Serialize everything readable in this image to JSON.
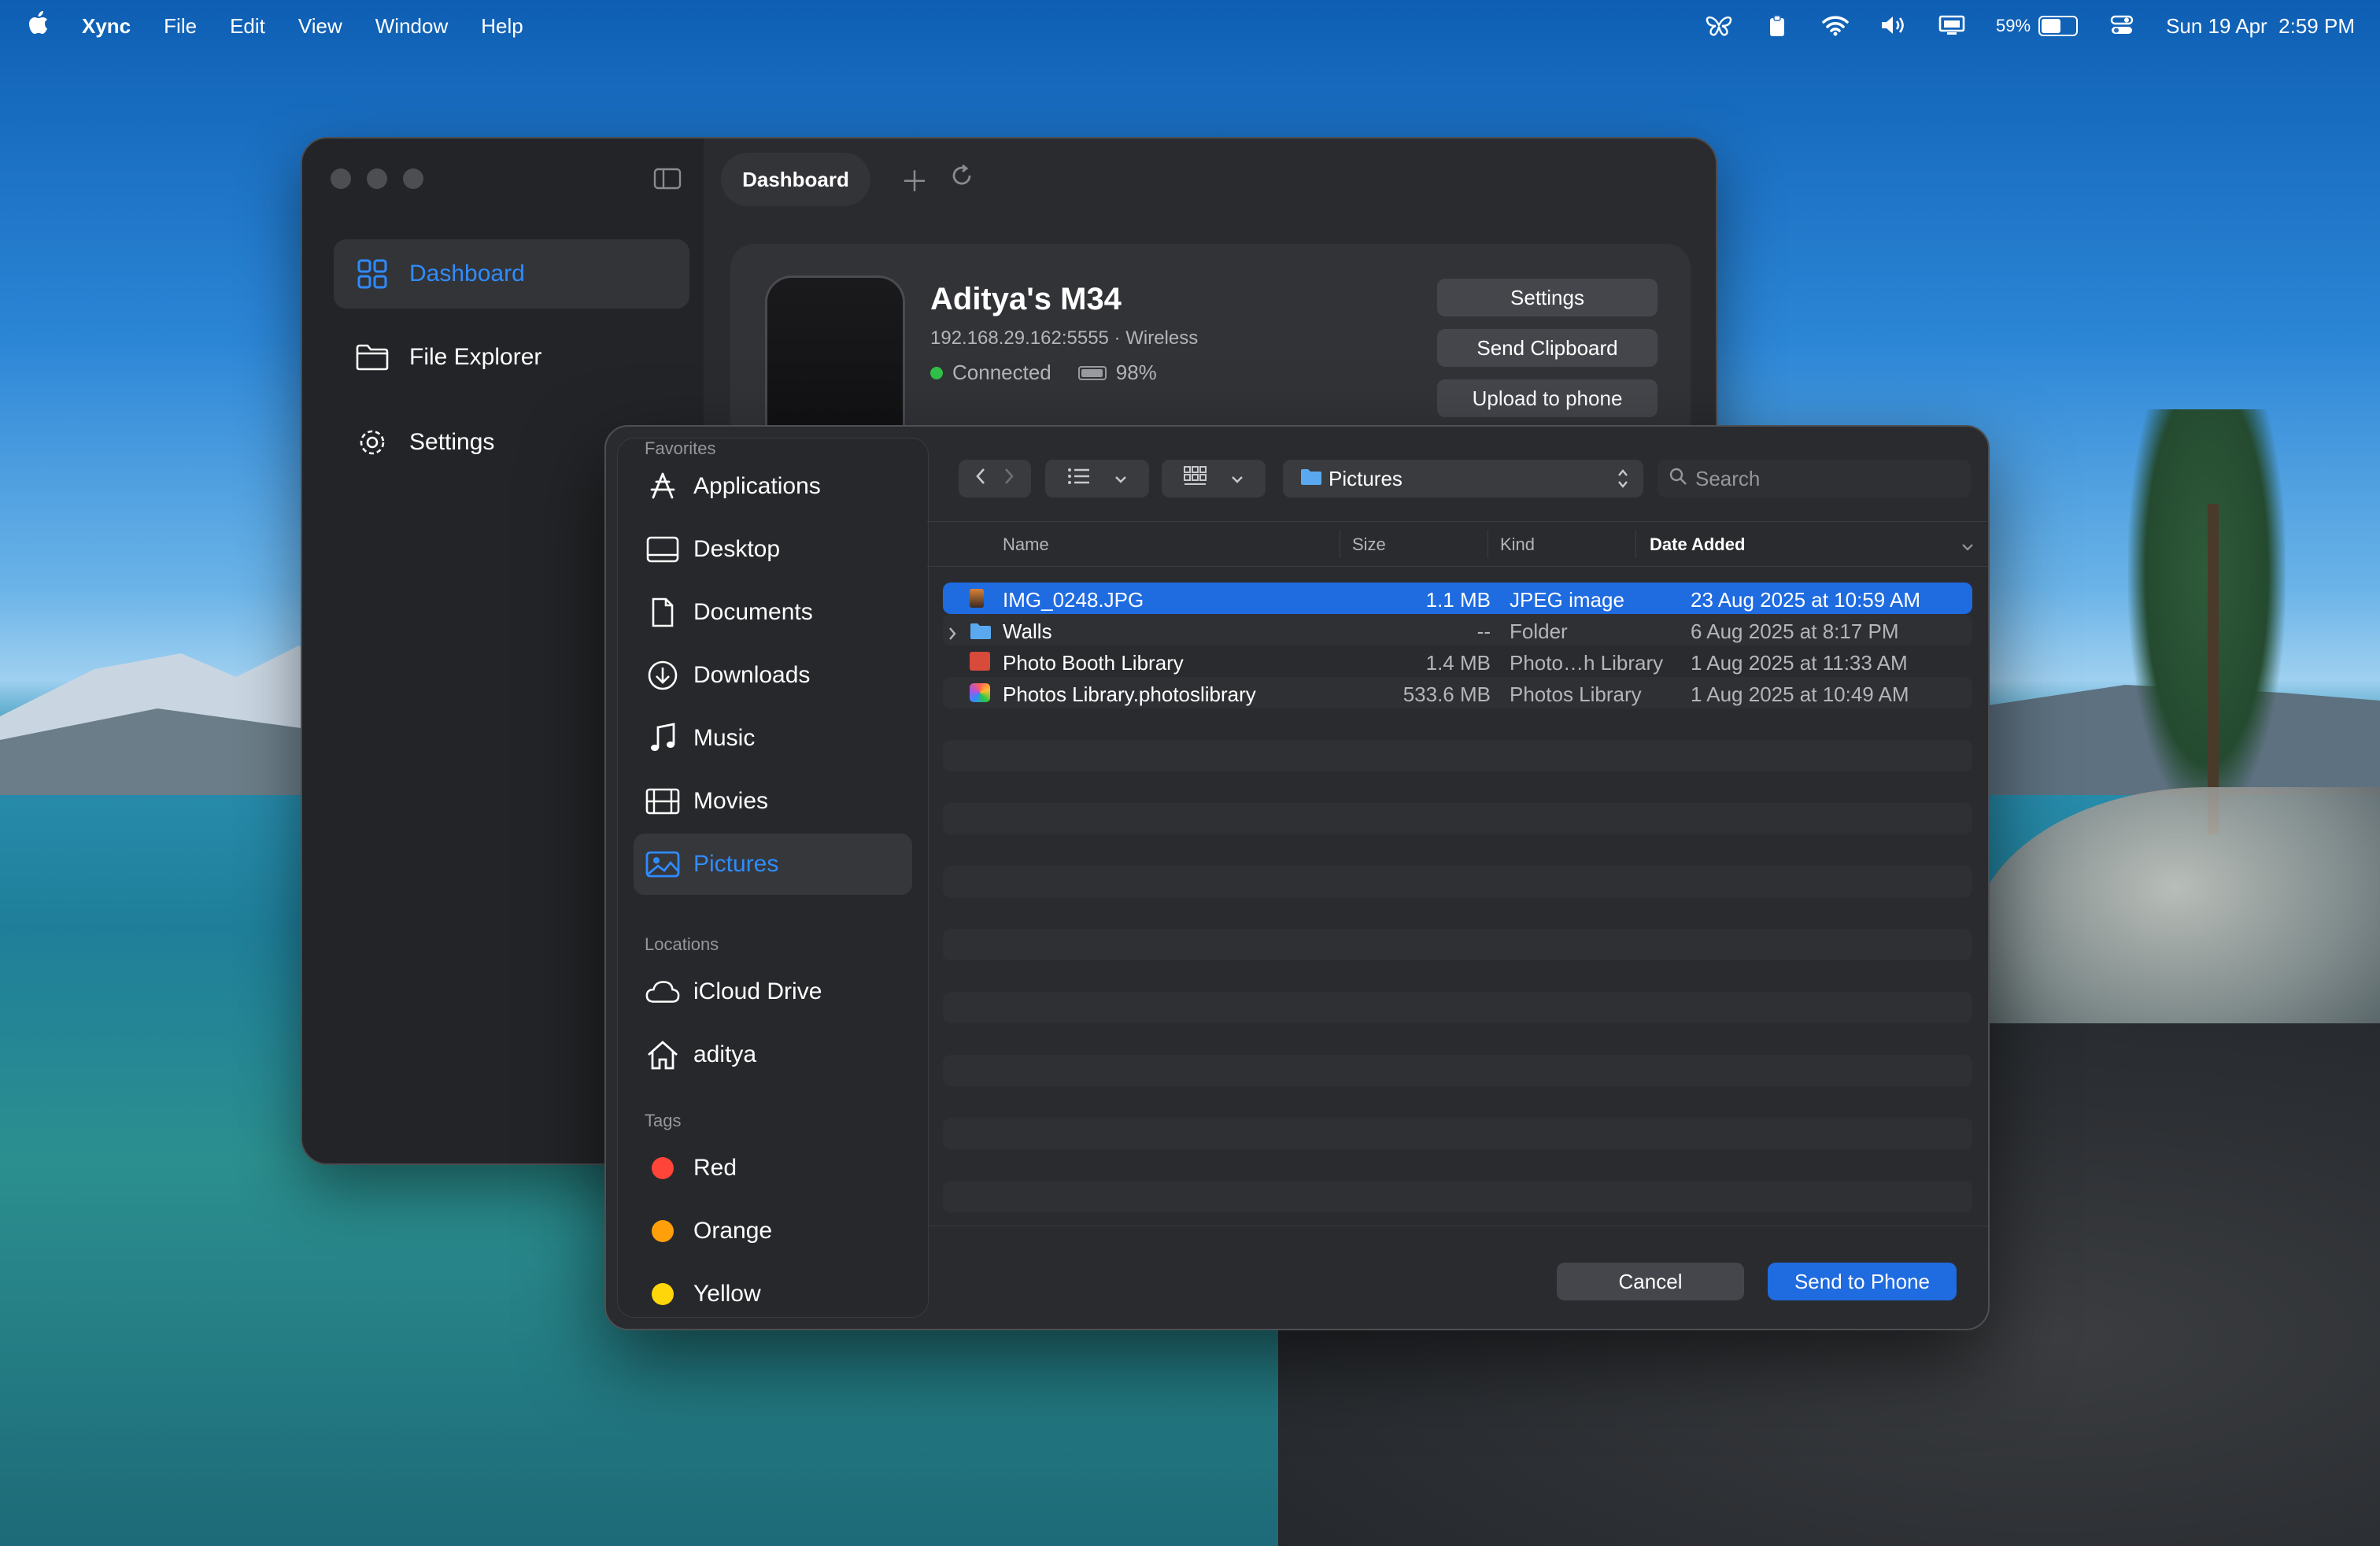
{
  "menubar": {
    "app_name": "Xync",
    "menus": [
      "File",
      "Edit",
      "View",
      "Window",
      "Help"
    ],
    "battery_percent": "59%",
    "battery_level": 0.59,
    "datetime": "Sun 19 Apr  2:59 PM"
  },
  "window": {
    "tab_title": "Dashboard",
    "sidebar": {
      "items": [
        {
          "label": "Dashboard",
          "icon": "grid-icon"
        },
        {
          "label": "File Explorer",
          "icon": "folder-icon"
        },
        {
          "label": "Settings",
          "icon": "gear-icon"
        }
      ]
    },
    "device": {
      "name": "Aditya's M34",
      "address": "192.168.29.162:5555 · Wireless",
      "status": "Connected",
      "battery": "98%",
      "battery_level": 0.98,
      "buttons": [
        "Settings",
        "Send Clipboard",
        "Upload to phone"
      ]
    }
  },
  "dialog": {
    "favorites_label": "Favorites",
    "favorites": [
      {
        "label": "Applications",
        "icon": "applications-icon"
      },
      {
        "label": "Desktop",
        "icon": "desktop-icon"
      },
      {
        "label": "Documents",
        "icon": "document-icon"
      },
      {
        "label": "Downloads",
        "icon": "download-icon"
      },
      {
        "label": "Music",
        "icon": "music-icon"
      },
      {
        "label": "Movies",
        "icon": "film-icon"
      },
      {
        "label": "Pictures",
        "icon": "pictures-icon"
      }
    ],
    "locations_label": "Locations",
    "locations": [
      {
        "label": "iCloud Drive",
        "icon": "cloud-icon"
      },
      {
        "label": "aditya",
        "icon": "home-icon"
      }
    ],
    "tags_label": "Tags",
    "tags": [
      {
        "label": "Red",
        "color": "#ff453a"
      },
      {
        "label": "Orange",
        "color": "#ff9f0a"
      },
      {
        "label": "Yellow",
        "color": "#ffd60a"
      }
    ],
    "current_folder": "Pictures",
    "search_placeholder": "Search",
    "columns": {
      "name": "Name",
      "size": "Size",
      "kind": "Kind",
      "date": "Date Added"
    },
    "files": [
      {
        "name": "IMG_0248.JPG",
        "size": "1.1 MB",
        "kind": "JPEG image",
        "date": "23 Aug 2025 at 10:59 AM",
        "selected": true
      },
      {
        "name": "Walls",
        "size": "--",
        "kind": "Folder",
        "date": "6 Aug 2025 at 8:17 PM",
        "selected": false
      },
      {
        "name": "Photo Booth Library",
        "size": "1.4 MB",
        "kind": "Photo…h Library",
        "date": "1 Aug 2025 at 11:33 AM",
        "selected": false
      },
      {
        "name": "Photos Library.photoslibrary",
        "size": "533.6 MB",
        "kind": "Photos Library",
        "date": "1 Aug 2025 at 10:49 AM",
        "selected": false
      }
    ],
    "cancel_label": "Cancel",
    "send_label": "Send to Phone"
  }
}
